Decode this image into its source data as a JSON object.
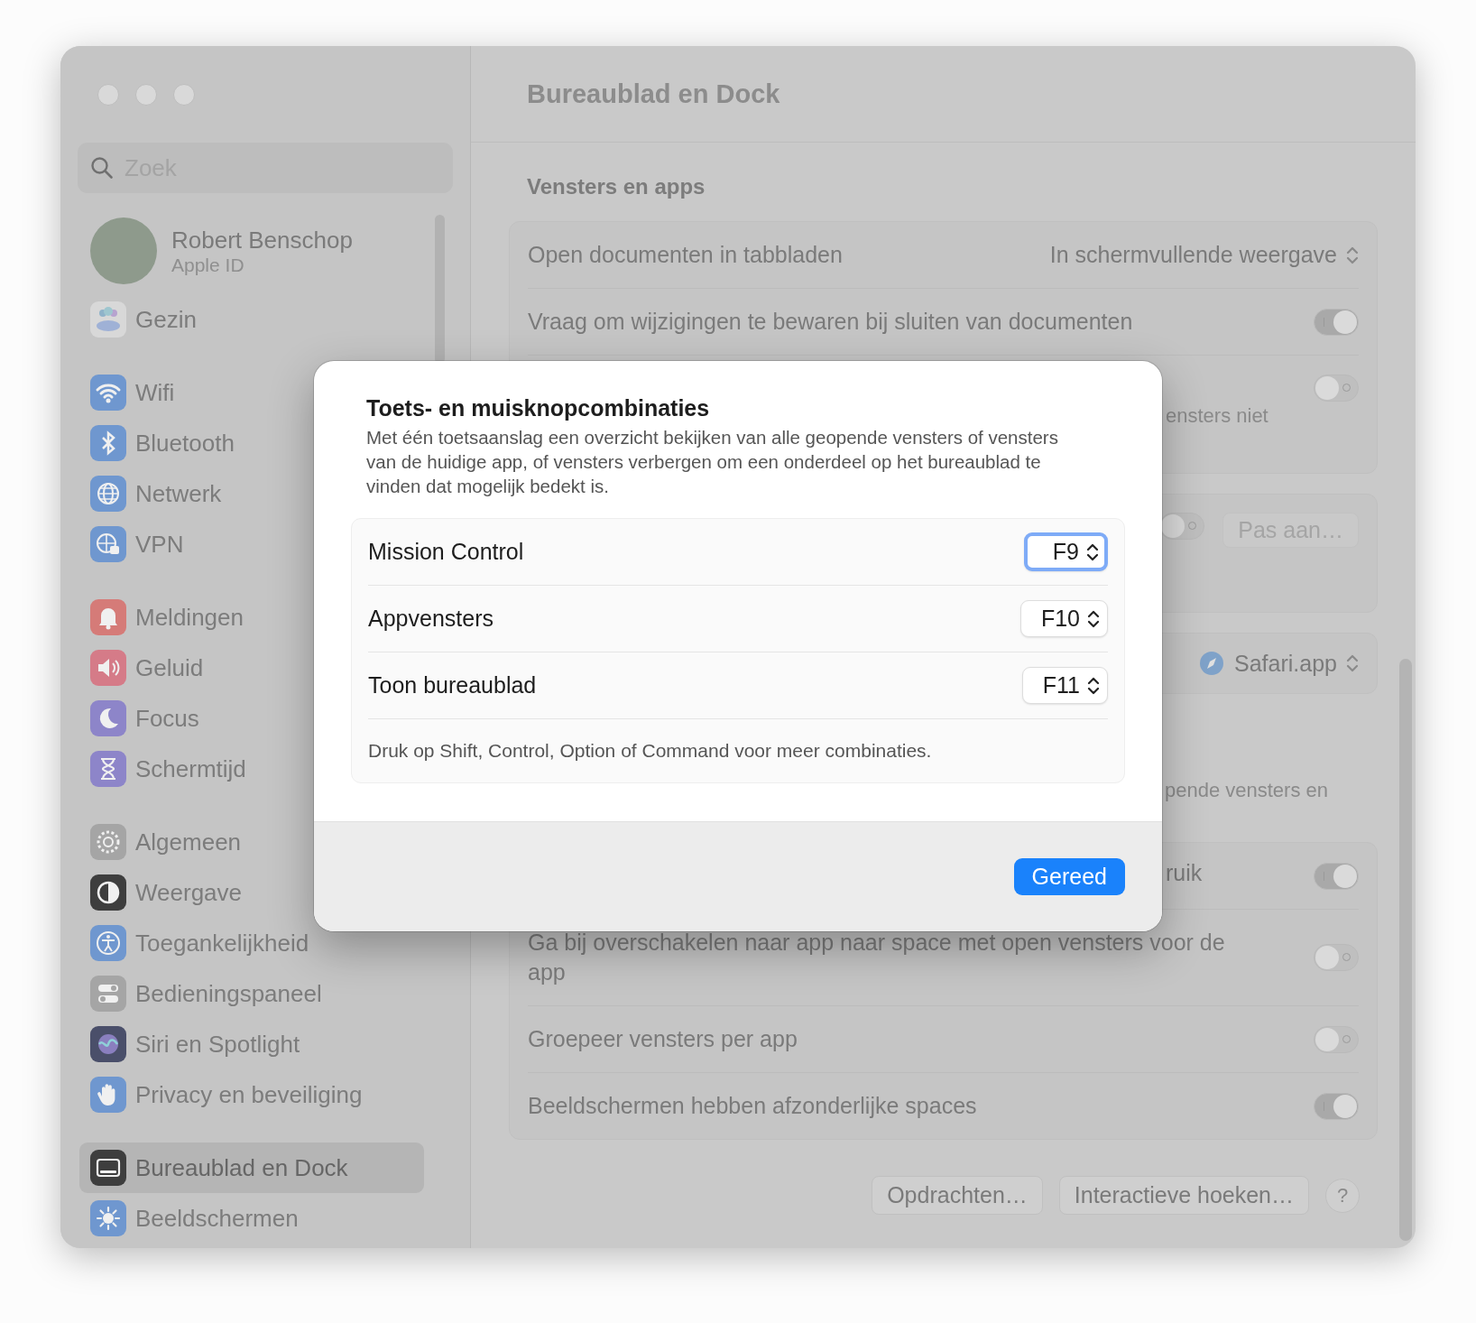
{
  "sidebar": {
    "search": {
      "placeholder": "Zoek"
    },
    "account": {
      "name": "Robert Benschop",
      "subtitle": "Apple ID"
    },
    "groups": [
      [
        {
          "label": "Gezin",
          "selected": false
        }
      ],
      [
        {
          "label": "Wifi",
          "selected": false
        },
        {
          "label": "Bluetooth",
          "selected": false
        },
        {
          "label": "Netwerk",
          "selected": false
        },
        {
          "label": "VPN",
          "selected": false
        }
      ],
      [
        {
          "label": "Meldingen",
          "selected": false
        },
        {
          "label": "Geluid",
          "selected": false
        },
        {
          "label": "Focus",
          "selected": false
        },
        {
          "label": "Schermtijd",
          "selected": false
        }
      ],
      [
        {
          "label": "Algemeen",
          "selected": false
        },
        {
          "label": "Weergave",
          "selected": false
        },
        {
          "label": "Toegankelijkheid",
          "selected": false
        },
        {
          "label": "Bedieningspaneel",
          "selected": false
        },
        {
          "label": "Siri en Spotlight",
          "selected": false
        },
        {
          "label": "Privacy en beveiliging",
          "selected": false
        }
      ],
      [
        {
          "label": "Bureaublad en Dock",
          "selected": true
        },
        {
          "label": "Beeldschermen",
          "selected": false
        }
      ]
    ]
  },
  "content": {
    "title": "Bureaublad en Dock",
    "section": "Vensters en apps",
    "blocks": [
      {
        "kind": "group",
        "rows": [
          {
            "kind": "popup",
            "label": "Open documenten in tabbladen",
            "value": "In schermvullende weergave"
          },
          {
            "kind": "toggle",
            "label": "Vraag om wijzigingen te bewaren bij sluiten van documenten",
            "on": true
          },
          {
            "kind": "covered_toggle",
            "on": false,
            "note": "ensters niet"
          }
        ]
      },
      {
        "kind": "group",
        "rows": [
          {
            "kind": "toggle_button",
            "on": false,
            "button": "Pas aan…"
          }
        ]
      },
      {
        "kind": "group",
        "rows": [
          {
            "kind": "app_popup",
            "value": "Safari.app"
          }
        ]
      },
      {
        "kind": "note",
        "text": "pende vensters en"
      },
      {
        "kind": "group",
        "rows": [
          {
            "kind": "covered_toggle",
            "label": "ruik",
            "on": true
          },
          {
            "kind": "toggle",
            "label": "Ga bij overschakelen naar app naar space met open vensters voor de app",
            "on": false
          },
          {
            "kind": "toggle",
            "label": "Groepeer vensters per app",
            "on": false
          },
          {
            "kind": "toggle",
            "label": "Beeldschermen hebben afzonderlijke spaces",
            "on": true
          }
        ]
      }
    ],
    "buttons": [
      {
        "label": "Opdrachten…"
      },
      {
        "label": "Interactieve hoeken…"
      }
    ],
    "help": "?"
  },
  "dialog": {
    "title": "Toets- en muisknopcombinaties",
    "description": "Met één toetsaanslag een overzicht bekijken van alle geopende vensters of vensters van de huidige app, of vensters verbergen om een onderdeel op het bureaublad te vinden dat mogelijk bedekt is.",
    "shortcuts": [
      {
        "label": "Mission Control",
        "key": "F9",
        "focused": true
      },
      {
        "label": "Appvensters",
        "key": "F10",
        "focused": false
      },
      {
        "label": "Toon bureaublad",
        "key": "F11",
        "focused": false
      }
    ],
    "hint": "Druk op Shift, Control, Option of Command voor meer combinaties.",
    "button": "Gereed"
  }
}
